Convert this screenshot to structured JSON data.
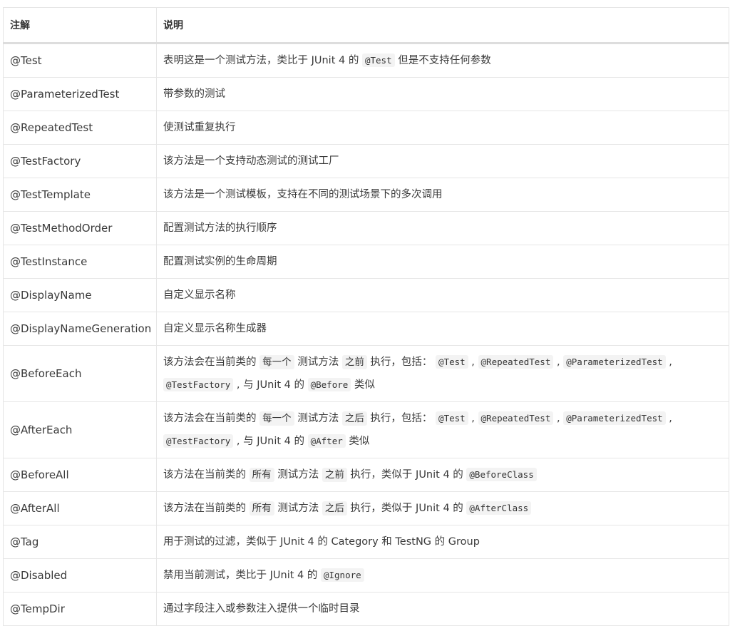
{
  "header": {
    "col1": "注解",
    "col2": "说明"
  },
  "rows": [
    {
      "annotation": "@Test",
      "desc": [
        {
          "t": "text",
          "v": "表明这是一个测试方法，类比于 JUnit 4 的 "
        },
        {
          "t": "code",
          "v": "@Test"
        },
        {
          "t": "text",
          "v": " 但是不支持任何参数"
        }
      ]
    },
    {
      "annotation": "@ParameterizedTest",
      "desc": [
        {
          "t": "text",
          "v": "带参数的测试"
        }
      ]
    },
    {
      "annotation": "@RepeatedTest",
      "desc": [
        {
          "t": "text",
          "v": "使测试重复执行"
        }
      ]
    },
    {
      "annotation": "@TestFactory",
      "desc": [
        {
          "t": "text",
          "v": "该方法是一个支持动态测试的测试工厂"
        }
      ]
    },
    {
      "annotation": "@TestTemplate",
      "desc": [
        {
          "t": "text",
          "v": "该方法是一个测试模板，支持在不同的测试场景下的多次调用"
        }
      ]
    },
    {
      "annotation": "@TestMethodOrder",
      "desc": [
        {
          "t": "text",
          "v": "配置测试方法的执行顺序"
        }
      ]
    },
    {
      "annotation": "@TestInstance",
      "desc": [
        {
          "t": "text",
          "v": "配置测试实例的生命周期"
        }
      ]
    },
    {
      "annotation": "@DisplayName",
      "desc": [
        {
          "t": "text",
          "v": "自定义显示名称"
        }
      ]
    },
    {
      "annotation": "@DisplayNameGeneration",
      "desc": [
        {
          "t": "text",
          "v": "自定义显示名称生成器"
        }
      ]
    },
    {
      "annotation": "@BeforeEach",
      "tall": true,
      "desc": [
        {
          "t": "text",
          "v": "该方法会在当前类的 "
        },
        {
          "t": "hl",
          "v": "每一个"
        },
        {
          "t": "text",
          "v": " 测试方法 "
        },
        {
          "t": "hl",
          "v": "之前"
        },
        {
          "t": "text",
          "v": " 执行，包括： "
        },
        {
          "t": "code",
          "v": "@Test"
        },
        {
          "t": "text",
          "v": " , "
        },
        {
          "t": "code",
          "v": "@RepeatedTest"
        },
        {
          "t": "text",
          "v": " , "
        },
        {
          "t": "code",
          "v": "@ParameterizedTest"
        },
        {
          "t": "text",
          "v": " , "
        },
        {
          "t": "code",
          "v": "@TestFactory"
        },
        {
          "t": "text",
          "v": " , 与 JUnit 4 的 "
        },
        {
          "t": "code",
          "v": "@Before"
        },
        {
          "t": "text",
          "v": " 类似"
        }
      ]
    },
    {
      "annotation": "@AfterEach",
      "tall": true,
      "desc": [
        {
          "t": "text",
          "v": "该方法会在当前类的 "
        },
        {
          "t": "hl",
          "v": "每一个"
        },
        {
          "t": "text",
          "v": " 测试方法 "
        },
        {
          "t": "hl",
          "v": "之后"
        },
        {
          "t": "text",
          "v": " 执行，包括： "
        },
        {
          "t": "code",
          "v": "@Test"
        },
        {
          "t": "text",
          "v": " , "
        },
        {
          "t": "code",
          "v": "@RepeatedTest"
        },
        {
          "t": "text",
          "v": " , "
        },
        {
          "t": "code",
          "v": "@ParameterizedTest"
        },
        {
          "t": "text",
          "v": " , "
        },
        {
          "t": "code",
          "v": "@TestFactory"
        },
        {
          "t": "text",
          "v": " , 与 JUnit 4 的 "
        },
        {
          "t": "code",
          "v": "@After"
        },
        {
          "t": "text",
          "v": " 类似"
        }
      ]
    },
    {
      "annotation": "@BeforeAll",
      "desc": [
        {
          "t": "text",
          "v": "该方法在当前类的 "
        },
        {
          "t": "hl",
          "v": "所有"
        },
        {
          "t": "text",
          "v": " 测试方法 "
        },
        {
          "t": "hl",
          "v": "之前"
        },
        {
          "t": "text",
          "v": " 执行，类似于 JUnit 4 的 "
        },
        {
          "t": "code",
          "v": "@BeforeClass"
        }
      ]
    },
    {
      "annotation": "@AfterAll",
      "desc": [
        {
          "t": "text",
          "v": "该方法在当前类的 "
        },
        {
          "t": "hl",
          "v": "所有"
        },
        {
          "t": "text",
          "v": " 测试方法 "
        },
        {
          "t": "hl",
          "v": "之后"
        },
        {
          "t": "text",
          "v": " 执行，类似于 JUnit 4 的 "
        },
        {
          "t": "code",
          "v": "@AfterClass"
        }
      ]
    },
    {
      "annotation": "@Tag",
      "desc": [
        {
          "t": "text",
          "v": "用于测试的过滤，类似于 JUnit 4 的 Category 和 TestNG 的 Group"
        }
      ]
    },
    {
      "annotation": "@Disabled",
      "desc": [
        {
          "t": "text",
          "v": "禁用当前测试，类比于 JUnit 4 的 "
        },
        {
          "t": "code",
          "v": "@Ignore"
        }
      ]
    },
    {
      "annotation": "@TempDir",
      "desc": [
        {
          "t": "text",
          "v": "通过字段注入或参数注入提供一个临时目录"
        }
      ]
    }
  ]
}
